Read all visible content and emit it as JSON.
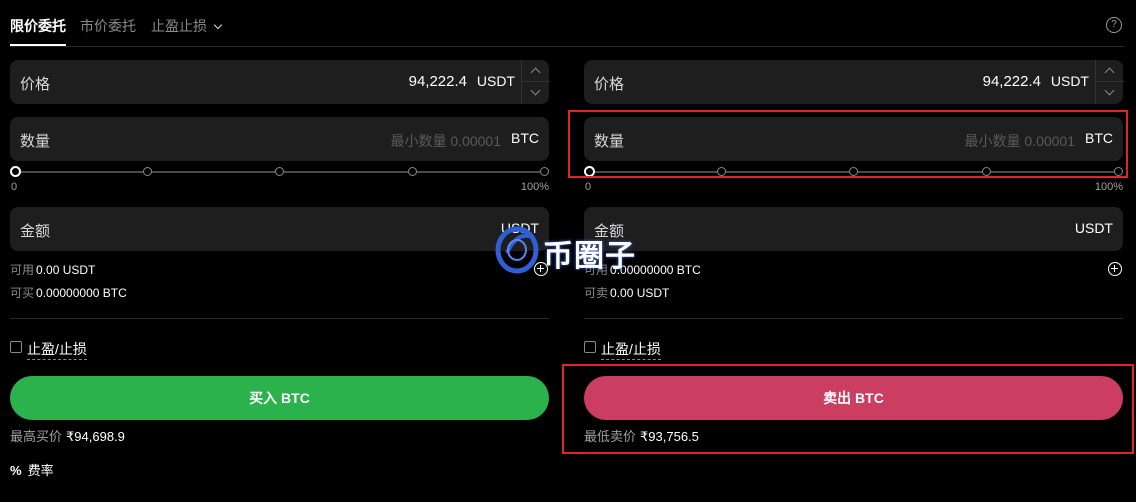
{
  "tabs": [
    {
      "label": "限价委托",
      "active": true
    },
    {
      "label": "市价委托",
      "active": false
    },
    {
      "label": "止盈止损",
      "active": false
    }
  ],
  "help_icon": "?",
  "buy": {
    "price_label": "价格",
    "price_value": "94,222.4",
    "price_unit": "USDT",
    "qty_label": "数量",
    "qty_placeholder": "最小数量 0.00001",
    "qty_unit": "BTC",
    "slider_min": "0",
    "slider_max": "100%",
    "slider_value_pct": 0,
    "amount_label": "金额",
    "amount_unit": "USDT",
    "available_label": "可用",
    "available_value": "0.00 USDT",
    "can_label": "可买",
    "can_value": "0.00000000 BTC",
    "tpsl_label": "止盈/止损",
    "button_label": "买入 BTC",
    "best_label": "最高买价",
    "best_value": "₹94,698.9"
  },
  "sell": {
    "price_label": "价格",
    "price_value": "94,222.4",
    "price_unit": "USDT",
    "qty_label": "数量",
    "qty_placeholder": "最小数量 0.00001",
    "qty_unit": "BTC",
    "slider_min": "0",
    "slider_max": "100%",
    "slider_value_pct": 0,
    "amount_label": "金额",
    "amount_unit": "USDT",
    "available_label": "可用",
    "available_value": "0.00000000 BTC",
    "can_label": "可卖",
    "can_value": "0.00 USDT",
    "tpsl_label": "止盈/止损",
    "button_label": "卖出 BTC",
    "best_label": "最低卖价",
    "best_value": "₹93,756.5"
  },
  "fee": {
    "icon": "%",
    "label": "费率"
  },
  "watermark": {
    "text": "币圈子"
  },
  "colors": {
    "buy": "#2bb24c",
    "sell": "#cc3d62",
    "highlight": "#e0242c",
    "field_bg": "#1e1e1e"
  }
}
